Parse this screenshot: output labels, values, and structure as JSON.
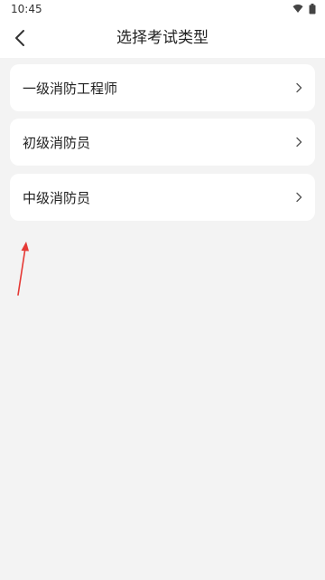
{
  "status_bar": {
    "time": "10:45",
    "icons": [
      "wifi-icon",
      "battery-icon"
    ]
  },
  "header": {
    "title": "选择考试类型",
    "back_icon": "chevron-left-icon"
  },
  "options": [
    {
      "label": "一级消防工程师"
    },
    {
      "label": "初级消防员"
    },
    {
      "label": "中级消防员"
    }
  ],
  "colors": {
    "background": "#f3f3f3",
    "card": "#ffffff",
    "annotation_arrow": "#e53935"
  }
}
